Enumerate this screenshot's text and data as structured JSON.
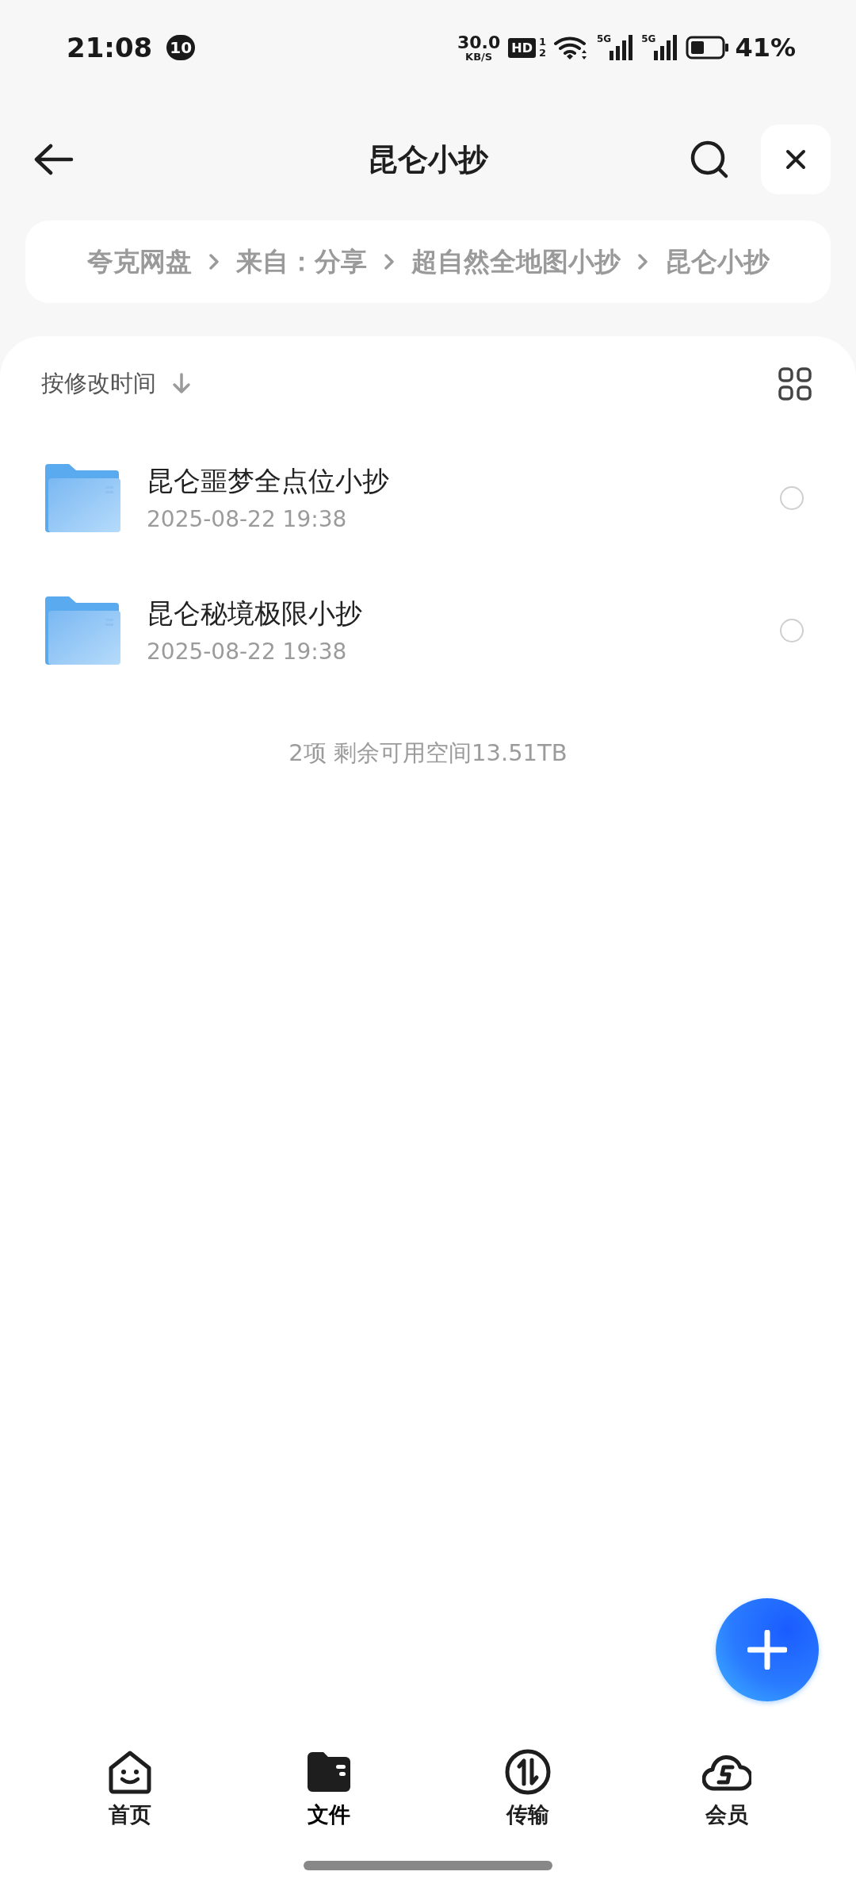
{
  "status_bar": {
    "time": "21:08",
    "notification_count": "10",
    "net_speed": "30.0",
    "net_unit": "KB/S",
    "hd_label": "HD",
    "sim_slots": [
      "1",
      "2"
    ],
    "signals": [
      "5G",
      "5G"
    ],
    "battery": "41%"
  },
  "header": {
    "title": "昆仑小抄"
  },
  "breadcrumb": [
    "夸克网盘",
    "来自：分享",
    "超自然全地图小抄",
    "昆仑小抄"
  ],
  "sort": {
    "label": "按修改时间"
  },
  "files": [
    {
      "name": "昆仑噩梦全点位小抄",
      "date": "2025-08-22 19:38",
      "selected": false
    },
    {
      "name": "昆仑秘境极限小抄",
      "date": "2025-08-22 19:38",
      "selected": false
    }
  ],
  "summary": "2项 剩余可用空间13.51TB",
  "nav": [
    {
      "label": "首页",
      "kind": "home",
      "selected": false
    },
    {
      "label": "文件",
      "kind": "files",
      "selected": true
    },
    {
      "label": "传输",
      "kind": "transfer",
      "selected": false
    },
    {
      "label": "会员",
      "kind": "member",
      "selected": false
    }
  ]
}
